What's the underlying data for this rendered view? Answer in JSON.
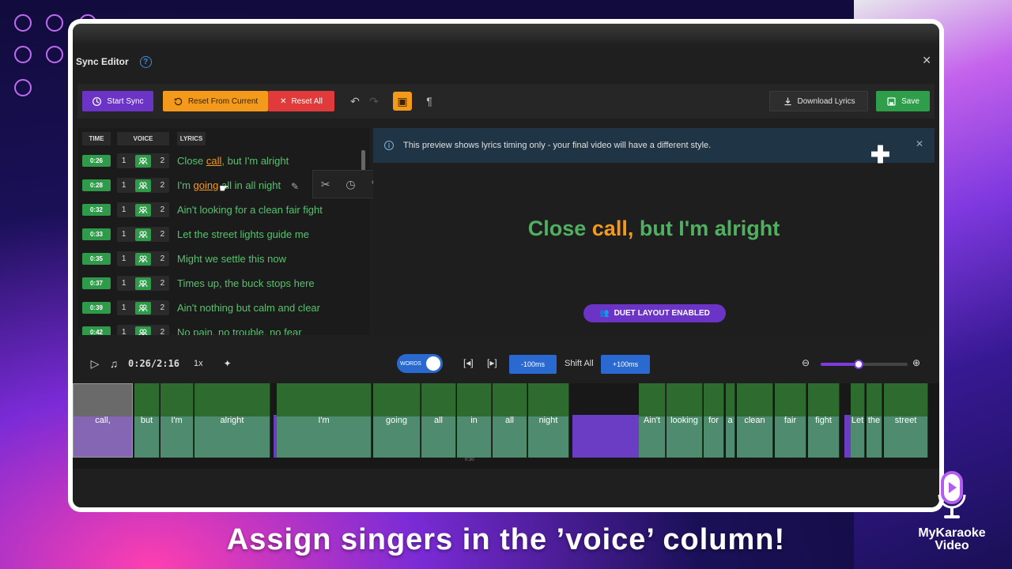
{
  "editor": {
    "title": "Sync Editor",
    "help_icon": "question-icon",
    "close_icon": "close-icon"
  },
  "toolbar": {
    "start_sync": "Start Sync",
    "reset_from_current": "Reset From Current",
    "reset_all": "Reset All",
    "download": "Download Lyrics",
    "save": "Save"
  },
  "lyrics": {
    "headers": {
      "time": "TIME",
      "voice": "VOICE",
      "lyrics": "LYRICS"
    },
    "rows": [
      {
        "time": "0:26",
        "v1": "1",
        "v2": "2",
        "pre": "Close ",
        "hl": "call",
        "post": ", but I'm alright"
      },
      {
        "time": "0:28",
        "v1": "1",
        "v2": "2",
        "pre": "I'm ",
        "hl": "going",
        "post": " all in all night"
      },
      {
        "time": "0:32",
        "v1": "1",
        "v2": "2",
        "pre": "Ain't looking for a clean fair fight",
        "hl": "",
        "post": ""
      },
      {
        "time": "0:33",
        "v1": "1",
        "v2": "2",
        "pre": "Let the street lights guide me",
        "hl": "",
        "post": ""
      },
      {
        "time": "0:35",
        "v1": "1",
        "v2": "2",
        "pre": "Might we settle this now",
        "hl": "",
        "post": ""
      },
      {
        "time": "0:37",
        "v1": "1",
        "v2": "2",
        "pre": "Times up, the buck stops here",
        "hl": "",
        "post": ""
      },
      {
        "time": "0:39",
        "v1": "1",
        "v2": "2",
        "pre": "Ain't nothing but calm and clear",
        "hl": "",
        "post": ""
      },
      {
        "time": "0:42",
        "v1": "1",
        "v2": "2",
        "pre": "No pain, no trouble, no fear",
        "hl": "",
        "post": ""
      }
    ]
  },
  "preview": {
    "info": "This preview shows lyrics timing only - your final video will have a different style.",
    "line_pre": "Close ",
    "line_hl": "call,",
    "line_post": " but I'm alright",
    "duet": "DUET LAYOUT ENABLED"
  },
  "transport": {
    "time": "0:26/2:16",
    "speed": "1x",
    "toggle_label": "WORDS",
    "minus": "-100ms",
    "shift_all": "Shift All",
    "plus": "+100ms"
  },
  "timeline": {
    "words": [
      "call,",
      "but",
      "I'm",
      "alright",
      "I'm",
      "going",
      "all",
      "in",
      "all",
      "night",
      "Ain't",
      "looking",
      "for",
      "a",
      "clean",
      "fair",
      "fight",
      "Let",
      "the",
      "street"
    ],
    "tick": "0:30"
  },
  "caption": "Assign singers in the ’voice’ column!",
  "logo": {
    "line1": "MyKaraoke",
    "line2": "Video"
  },
  "colors": {
    "green": "#2f9a4a",
    "orange": "#f39a1d",
    "purple": "#6b34c7",
    "red": "#e03a3a",
    "blue": "#2a6ad0"
  }
}
